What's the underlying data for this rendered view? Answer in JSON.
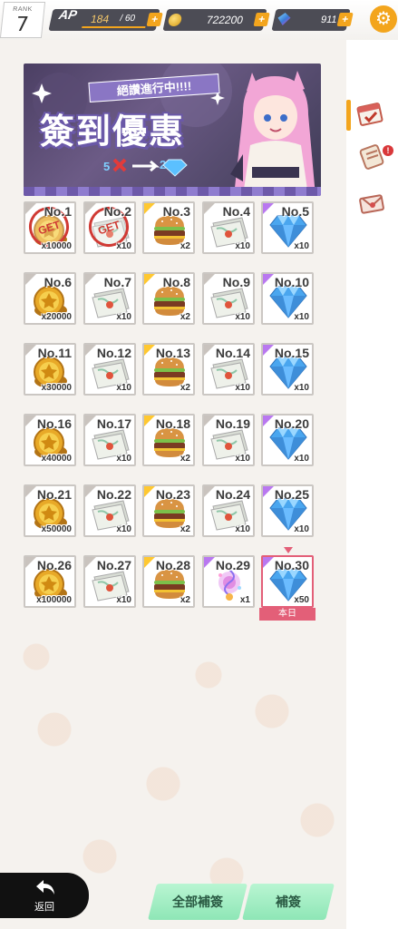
{
  "header": {
    "rank_label": "RANK",
    "rank_value": "7",
    "ap_label": "AP",
    "ap_current": "184",
    "ap_max": "/ 60",
    "coins": "722200",
    "gems": "911",
    "plus": "+",
    "ap_fill": 1.0
  },
  "banner": {
    "ribbon_text": "絕讚進行中!!!!",
    "title": "簽到優惠",
    "sub_left": "5",
    "sub_right": "2"
  },
  "sidebar": {
    "badge": "!"
  },
  "calendar": {
    "days": [
      {
        "day": "No.1",
        "item": "coin",
        "qty": "x10000",
        "claimed": true
      },
      {
        "day": "No.2",
        "item": "ticket",
        "qty": "x10",
        "claimed": true
      },
      {
        "day": "No.3",
        "item": "burger",
        "qty": "x2",
        "claimed": false
      },
      {
        "day": "No.4",
        "item": "ticket",
        "qty": "x10",
        "claimed": false
      },
      {
        "day": "No.5",
        "item": "gem",
        "qty": "x10",
        "claimed": false
      },
      {
        "day": "No.6",
        "item": "coin",
        "qty": "x20000",
        "claimed": false
      },
      {
        "day": "No.7",
        "item": "ticket",
        "qty": "x10",
        "claimed": false
      },
      {
        "day": "No.8",
        "item": "burger",
        "qty": "x2",
        "claimed": false
      },
      {
        "day": "No.9",
        "item": "ticket",
        "qty": "x10",
        "claimed": false
      },
      {
        "day": "No.10",
        "item": "gem",
        "qty": "x10",
        "claimed": false
      },
      {
        "day": "No.11",
        "item": "coin",
        "qty": "x30000",
        "claimed": false
      },
      {
        "day": "No.12",
        "item": "ticket",
        "qty": "x10",
        "claimed": false
      },
      {
        "day": "No.13",
        "item": "burger",
        "qty": "x2",
        "claimed": false
      },
      {
        "day": "No.14",
        "item": "ticket",
        "qty": "x10",
        "claimed": false
      },
      {
        "day": "No.15",
        "item": "gem",
        "qty": "x10",
        "claimed": false
      },
      {
        "day": "No.16",
        "item": "coin",
        "qty": "x40000",
        "claimed": false
      },
      {
        "day": "No.17",
        "item": "ticket",
        "qty": "x10",
        "claimed": false
      },
      {
        "day": "No.18",
        "item": "burger",
        "qty": "x2",
        "claimed": false
      },
      {
        "day": "No.19",
        "item": "ticket",
        "qty": "x10",
        "claimed": false
      },
      {
        "day": "No.20",
        "item": "gem",
        "qty": "x10",
        "claimed": false
      },
      {
        "day": "No.21",
        "item": "coin",
        "qty": "x50000",
        "claimed": false
      },
      {
        "day": "No.22",
        "item": "ticket",
        "qty": "x10",
        "claimed": false
      },
      {
        "day": "No.23",
        "item": "burger",
        "qty": "x2",
        "claimed": false
      },
      {
        "day": "No.24",
        "item": "ticket",
        "qty": "x10",
        "claimed": false
      },
      {
        "day": "No.25",
        "item": "gem",
        "qty": "x10",
        "claimed": false
      },
      {
        "day": "No.26",
        "item": "coin",
        "qty": "x100000",
        "claimed": false
      },
      {
        "day": "No.27",
        "item": "ticket",
        "qty": "x10",
        "claimed": false
      },
      {
        "day": "No.28",
        "item": "burger",
        "qty": "x2",
        "claimed": false
      },
      {
        "day": "No.29",
        "item": "orb",
        "qty": "x1",
        "claimed": false
      },
      {
        "day": "No.30",
        "item": "gem",
        "qty": "x50",
        "claimed": false,
        "today": true
      }
    ],
    "stamp_text": "GET",
    "today_label": "本日"
  },
  "footer": {
    "back_label": "返回",
    "claim_all_label": "全部補簽",
    "claim_label": "補簽"
  },
  "colors": {
    "accent": "#f3a51d",
    "today": "#e35f78",
    "claim_btn": "#a8eec6",
    "stamp": "#d03a34"
  }
}
